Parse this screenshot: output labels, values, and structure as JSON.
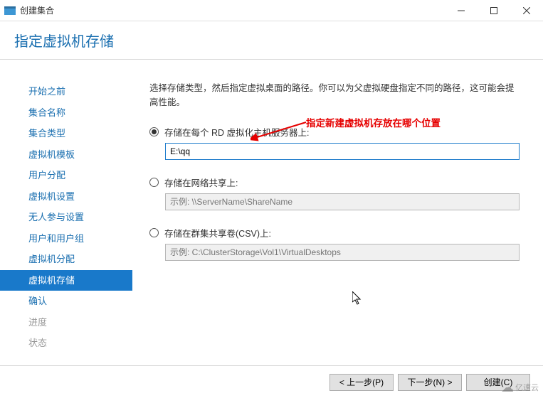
{
  "titlebar": {
    "title": "创建集合"
  },
  "header": {
    "page_title": "指定虚拟机存储"
  },
  "sidebar": {
    "items": [
      {
        "label": "开始之前",
        "state": "link"
      },
      {
        "label": "集合名称",
        "state": "link"
      },
      {
        "label": "集合类型",
        "state": "link"
      },
      {
        "label": "虚拟机模板",
        "state": "link"
      },
      {
        "label": "用户分配",
        "state": "link"
      },
      {
        "label": "虚拟机设置",
        "state": "link"
      },
      {
        "label": "无人参与设置",
        "state": "link"
      },
      {
        "label": "用户和用户组",
        "state": "link"
      },
      {
        "label": "虚拟机分配",
        "state": "link"
      },
      {
        "label": "虚拟机存储",
        "state": "selected"
      },
      {
        "label": "确认",
        "state": "link"
      },
      {
        "label": "进度",
        "state": "disabled"
      },
      {
        "label": "状态",
        "state": "disabled"
      }
    ]
  },
  "main": {
    "description": "选择存储类型，然后指定虚拟桌面的路径。你可以为父虚拟硬盘指定不同的路径，这可能会提高性能。",
    "options": {
      "opt1": {
        "label": "存储在每个 RD 虚拟化主机服务器上:",
        "value": "E:\\qq"
      },
      "opt2": {
        "label": "存储在网络共享上:",
        "placeholder": "示例: \\\\ServerName\\ShareName"
      },
      "opt3": {
        "label": "存储在群集共享卷(CSV)上:",
        "placeholder": "示例: C:\\ClusterStorage\\Vol1\\VirtualDesktops"
      }
    },
    "annotation": "指定新建虚拟机存放在哪个位置"
  },
  "footer": {
    "prev": "< 上一步(P)",
    "next": "下一步(N) >",
    "create": "创建(C)"
  },
  "watermark": "亿速云"
}
